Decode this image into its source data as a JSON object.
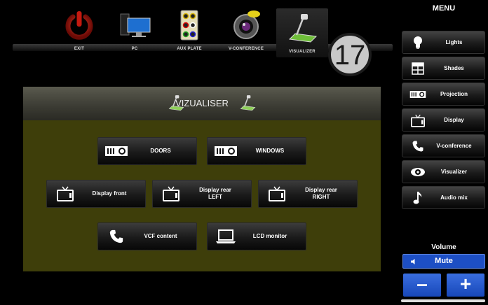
{
  "sources": [
    {
      "id": "exit",
      "label": "EXIT",
      "icon": "power-icon",
      "active": false
    },
    {
      "id": "pc",
      "label": "PC",
      "icon": "pc-icon",
      "active": false
    },
    {
      "id": "aux",
      "label": "AUX PLATE",
      "icon": "aux-plate-icon",
      "active": false
    },
    {
      "id": "vconf",
      "label": "V-CONFERENCE",
      "icon": "camera-icon",
      "active": false
    },
    {
      "id": "visualizer",
      "label": "VISUALIZER",
      "icon": "visualizer-icon",
      "active": true
    }
  ],
  "page_number": "17",
  "panel": {
    "title": "VIZUALISER",
    "buttons": [
      {
        "id": "doors",
        "label": "DOORS",
        "icon": "projector-icon"
      },
      {
        "id": "windows",
        "label": "WINDOWS",
        "icon": "projector-icon"
      },
      {
        "id": "display-front",
        "label": "Display front",
        "icon": "tv-icon"
      },
      {
        "id": "display-rear-left",
        "label": "Display rear\nLEFT",
        "icon": "tv-icon"
      },
      {
        "id": "display-rear-right",
        "label": "Display rear\nRIGHT",
        "icon": "tv-icon"
      },
      {
        "id": "vcf-content",
        "label": "VCF content",
        "icon": "phone-icon"
      },
      {
        "id": "lcd-monitor",
        "label": "LCD monitor",
        "icon": "laptop-icon"
      }
    ]
  },
  "menu": {
    "title": "MENU",
    "items": [
      {
        "label": "Lights",
        "icon": "bulb-icon"
      },
      {
        "label": "Shades",
        "icon": "shades-icon"
      },
      {
        "label": "Projection",
        "icon": "projector-icon"
      },
      {
        "label": "Display",
        "icon": "tv-icon"
      },
      {
        "label": "V-conference",
        "icon": "phone-icon"
      },
      {
        "label": "Visualizer",
        "icon": "eye-icon"
      },
      {
        "label": "Audio mix",
        "icon": "music-note-icon"
      }
    ]
  },
  "volume": {
    "title": "Volume",
    "mute_label": "Mute",
    "minus_label": "–",
    "plus_label": "+"
  },
  "colors": {
    "accent_blue": "#1d4fc4",
    "panel_olive": "#3e3e0a",
    "exit_red": "#b01010"
  }
}
